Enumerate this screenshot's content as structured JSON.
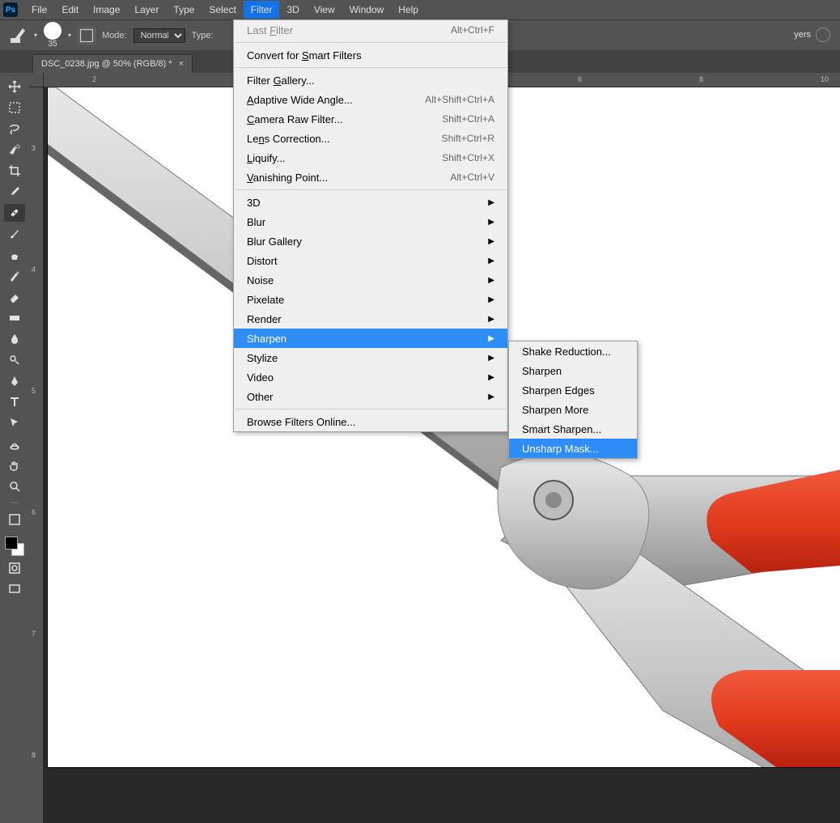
{
  "menubar": {
    "items": [
      "File",
      "Edit",
      "Image",
      "Layer",
      "Type",
      "Select",
      "Filter",
      "3D",
      "View",
      "Window",
      "Help"
    ],
    "active_index": 6
  },
  "optbar": {
    "brush_size": "35",
    "mode_label": "Mode:",
    "mode_value": "Normal",
    "type_label": "Type:"
  },
  "rpanel": {
    "label": "yers"
  },
  "tab": {
    "title": "DSC_0238.jpg @ 50% (RGB/8) *"
  },
  "ruler": {
    "h_ticks": [
      "2",
      "6",
      "8",
      "10"
    ],
    "v_ticks": [
      "3",
      "4",
      "5",
      "6",
      "7",
      "8"
    ]
  },
  "filter_menu": {
    "rows": [
      {
        "label": "Last Filter",
        "shortcut": "Alt+Ctrl+F",
        "disabled": true,
        "u": 5
      },
      {
        "sep": true
      },
      {
        "label": "Convert for Smart Filters",
        "u": 12
      },
      {
        "sep": true
      },
      {
        "label": "Filter Gallery...",
        "u": 7
      },
      {
        "label": "Adaptive Wide Angle...",
        "shortcut": "Alt+Shift+Ctrl+A",
        "u": 0
      },
      {
        "label": "Camera Raw Filter...",
        "shortcut": "Shift+Ctrl+A",
        "u": 0
      },
      {
        "label": "Lens Correction...",
        "shortcut": "Shift+Ctrl+R",
        "u": 2
      },
      {
        "label": "Liquify...",
        "shortcut": "Shift+Ctrl+X",
        "u": 0
      },
      {
        "label": "Vanishing Point...",
        "shortcut": "Alt+Ctrl+V",
        "u": 0
      },
      {
        "sep": true
      },
      {
        "label": "3D",
        "sub": true
      },
      {
        "label": "Blur",
        "sub": true
      },
      {
        "label": "Blur Gallery",
        "sub": true
      },
      {
        "label": "Distort",
        "sub": true
      },
      {
        "label": "Noise",
        "sub": true
      },
      {
        "label": "Pixelate",
        "sub": true
      },
      {
        "label": "Render",
        "sub": true
      },
      {
        "label": "Sharpen",
        "sub": true,
        "hl": true
      },
      {
        "label": "Stylize",
        "sub": true
      },
      {
        "label": "Video",
        "sub": true
      },
      {
        "label": "Other",
        "sub": true
      },
      {
        "sep": true
      },
      {
        "label": "Browse Filters Online..."
      }
    ]
  },
  "sharpen_submenu": {
    "rows": [
      {
        "label": "Shake Reduction..."
      },
      {
        "label": "Sharpen"
      },
      {
        "label": "Sharpen Edges"
      },
      {
        "label": "Sharpen More"
      },
      {
        "label": "Smart Sharpen..."
      },
      {
        "label": "Unsharp Mask...",
        "hl": true
      }
    ]
  },
  "tools": [
    "move",
    "marquee",
    "lasso",
    "quick-select",
    "crop",
    "eyedropper",
    "healing",
    "brush",
    "clone",
    "history-brush",
    "eraser",
    "gradient",
    "blur",
    "dodge",
    "pen",
    "type",
    "path-select",
    "shape",
    "hand",
    "zoom"
  ]
}
